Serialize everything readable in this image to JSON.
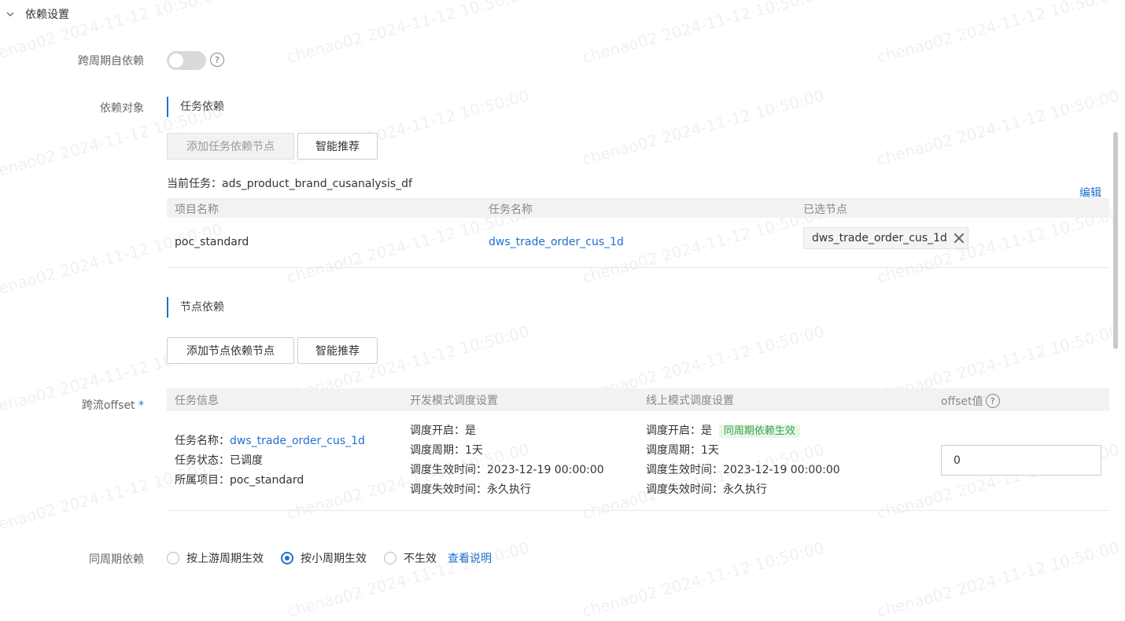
{
  "section": {
    "title": "依赖设置"
  },
  "cross_cycle": {
    "label": "跨周期自依赖",
    "enabled": false,
    "help": "?"
  },
  "dependency_target": {
    "label": "依赖对象",
    "task_dependency": {
      "heading": "任务依赖",
      "add_button": "添加任务依赖节点",
      "smart_button": "智能推荐",
      "current_task_label": "当前任务：",
      "current_task_value": "ads_product_brand_cusanalysis_df",
      "edit_link": "编辑",
      "columns": [
        "项目名称",
        "任务名称",
        "已选节点"
      ],
      "rows": [
        {
          "project": "poc_standard",
          "task": "dws_trade_order_cus_1d",
          "selected_node": "dws_trade_order_cus_1d"
        }
      ]
    },
    "node_dependency": {
      "heading": "节点依赖",
      "add_button": "添加节点依赖节点",
      "smart_button": "智能推荐"
    }
  },
  "offset": {
    "label": "跨流offset",
    "required_mark": "*",
    "columns": [
      "任务信息",
      "开发模式调度设置",
      "线上模式调度设置",
      "offset值"
    ],
    "help": "?",
    "row": {
      "task_info": {
        "name_label": "任务名称：",
        "name_value": "dws_trade_order_cus_1d",
        "status_label": "任务状态：",
        "status_value": "已调度",
        "project_label": "所属项目：",
        "project_value": "poc_standard"
      },
      "dev": {
        "enabled": "调度开启：是",
        "cycle": "调度周期：1天",
        "effective": "调度生效时间：2023-12-19 00:00:00",
        "expire": "调度失效时间：永久执行"
      },
      "prod": {
        "enabled_label": "调度开启：是",
        "badge": "同周期依赖生效",
        "cycle": "调度周期：1天",
        "effective": "调度生效时间：2023-12-19 00:00:00",
        "expire": "调度失效时间：永久执行"
      },
      "offset_value": "0"
    }
  },
  "same_cycle": {
    "label": "同周期依赖",
    "options": [
      "按上游周期生效",
      "按小周期生效",
      "不生效"
    ],
    "selected": "按小周期生效",
    "help_link": "查看说明"
  },
  "watermark": {
    "text": "chenao02 2024-11-12 10:50:00"
  },
  "colors": {
    "accent": "#1f6fcf",
    "badge_green": "#3aa14a"
  }
}
